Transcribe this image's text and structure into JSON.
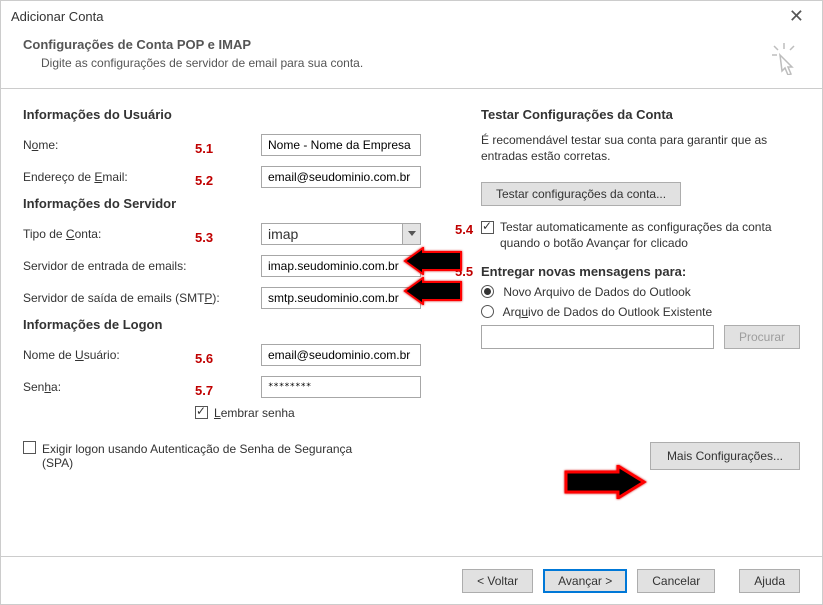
{
  "window": {
    "title": "Adicionar Conta"
  },
  "header": {
    "title": "Configurações de Conta POP e IMAP",
    "subtitle": "Digite as configurações de servidor de email para sua conta."
  },
  "left": {
    "userinfo_title": "Informações do Usuário",
    "nome_label_pre": "N",
    "nome_label_und": "o",
    "nome_label_post": "me:",
    "nome_value": "Nome - Nome da Empresa",
    "email_label_pre": "Endereço de ",
    "email_label_und": "E",
    "email_label_post": "mail:",
    "email_value": "email@seudominio.com.br",
    "serverinfo_title": "Informações do Servidor",
    "tipo_label_pre": "Tipo de ",
    "tipo_label_und": "C",
    "tipo_label_post": "onta:",
    "tipo_value": "imap",
    "serv_in_label_pre": "Servidor de entrada de emails:",
    "serv_in_value": "imap.seudominio.com.br",
    "serv_out_label_pre": "Servidor de saída de emails (SMT",
    "serv_out_label_und": "P",
    "serv_out_label_post": "):",
    "serv_out_value": "smtp.seudominio.com.br",
    "logon_title": "Informações de Logon",
    "user_label_pre": "Nome de ",
    "user_label_und": "U",
    "user_label_post": "suário:",
    "user_value": "email@seudominio.com.br",
    "senha_label_pre": "Sen",
    "senha_label_und": "h",
    "senha_label_post": "a:",
    "senha_value": "********",
    "lembrar_pre": "",
    "lembrar_und": "L",
    "lembrar_post": "embrar senha",
    "spa_pre": "Exigir logon usando Autenticação de Senha de Segurança (SPA)"
  },
  "right": {
    "test_title": "Testar Configurações da Conta",
    "test_para": "É recomendável testar sua conta para garantir que as entradas estão corretas.",
    "test_btn": "Testar configurações da conta...",
    "auto_test": "Testar automaticamente as configurações da conta quando o botão Avançar for clicado",
    "deliver_title": "Entregar novas mensagens para:",
    "radio_new": "Novo Arquivo de Dados do Outlook",
    "radio_exist_pre": "Arq",
    "radio_exist_und": "u",
    "radio_exist_post": "ivo de Dados do Outlook Existente",
    "browse_btn": "Procurar",
    "more_btn": "Mais Configurações..."
  },
  "nums": {
    "n51": "5.1",
    "n52": "5.2",
    "n53": "5.3",
    "n54": "5.4",
    "n55": "5.5",
    "n56": "5.6",
    "n57": "5.7"
  },
  "buttons": {
    "back": "< Voltar",
    "next": "Avançar >",
    "cancel": "Cancelar",
    "help": "Ajuda"
  }
}
